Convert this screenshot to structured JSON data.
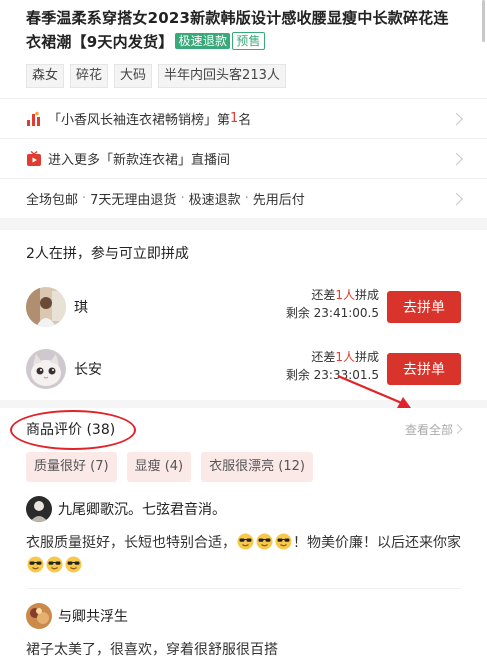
{
  "product": {
    "title": "春季温柔系穿搭女2023新款韩版设计感收腰显瘦中长款碎花连衣裙潮【9天内发货】",
    "badge_fast_refund": "极速退款",
    "badge_presale": "预售"
  },
  "tags": [
    "森女",
    "碎花",
    "大码",
    "半年内回头客213人"
  ],
  "ranking": {
    "prefix": "「小香风长袖连衣裙畅销榜」第",
    "rank": "1",
    "suffix": "名"
  },
  "live": {
    "text": "进入更多「新款连衣裙」直播间"
  },
  "services": [
    "全场包邮",
    "7天无理由退货",
    "极速退款",
    "先用后付"
  ],
  "group_buy": {
    "header": "2人在拼，参与可立即拼成",
    "groups": [
      {
        "name": "琪",
        "need_prefix": "还差",
        "need_count": "1人",
        "need_suffix": "拼成",
        "remaining": "剩余 23:41:00.5",
        "button": "去拼单"
      },
      {
        "name": "长安",
        "need_prefix": "还差",
        "need_count": "1人",
        "need_suffix": "拼成",
        "remaining": "剩余 23:33:01.5",
        "button": "去拼单"
      }
    ]
  },
  "reviews": {
    "title": "商品评价 (38)",
    "view_all": "查看全部",
    "chips": [
      "质量很好 (7)",
      "显瘦 (4)",
      "衣服很漂亮 (12)"
    ],
    "items": [
      {
        "user": "九尾卿歌沉。七弦君音消。",
        "text_a": "衣服质量挺好，长短也特别合适，",
        "text_b": "！物美价廉！以后还来你家"
      },
      {
        "user": "与卿共浮生",
        "text_a": "裙子太美了，很喜欢，穿着很舒服很百搭"
      }
    ]
  },
  "colors": {
    "accent_red": "#d9342b",
    "annotation_red": "#e0242a",
    "badge_green": "#3aa97a",
    "chip_bg": "#fbe9e8"
  },
  "icons": {
    "rank": "bar-chart-icon",
    "live": "tv-icon",
    "emoji": "sunglasses-emoji"
  }
}
